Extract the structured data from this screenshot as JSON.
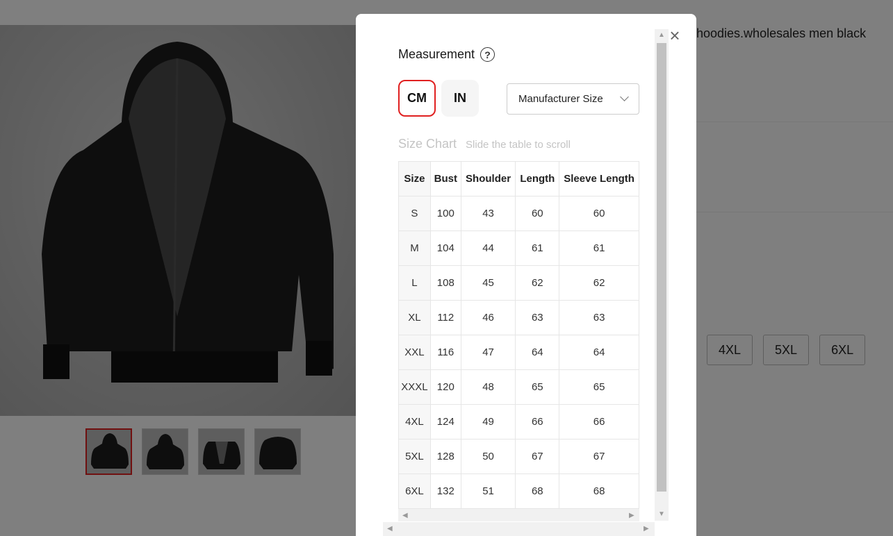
{
  "product": {
    "title": "hoodies.wholesales men black",
    "sizes": [
      "4XL",
      "5XL",
      "6XL"
    ]
  },
  "modal": {
    "title": "Measurement",
    "units": [
      "CM",
      "IN"
    ],
    "selected_unit": "CM",
    "size_type": "Manufacturer Size",
    "chart_heading": "Size Chart",
    "chart_hint": "Slide the table to scroll",
    "close_icon": "close-icon",
    "help_icon": "question-circle-icon"
  },
  "size_table": {
    "headers": [
      "Size",
      "Bust",
      "Shoulder",
      "Length",
      "Sleeve Length"
    ],
    "rows": [
      [
        "S",
        "100",
        "43",
        "60",
        "60"
      ],
      [
        "M",
        "104",
        "44",
        "61",
        "61"
      ],
      [
        "L",
        "108",
        "45",
        "62",
        "62"
      ],
      [
        "XL",
        "112",
        "46",
        "63",
        "63"
      ],
      [
        "XXL",
        "116",
        "47",
        "64",
        "64"
      ],
      [
        "XXXL",
        "120",
        "48",
        "65",
        "65"
      ],
      [
        "4XL",
        "124",
        "49",
        "66",
        "66"
      ],
      [
        "5XL",
        "128",
        "50",
        "67",
        "67"
      ],
      [
        "6XL",
        "132",
        "51",
        "68",
        "68"
      ]
    ]
  },
  "colors": {
    "accent": "#e02020",
    "overlay": "rgba(0,0,0,0.5)"
  }
}
